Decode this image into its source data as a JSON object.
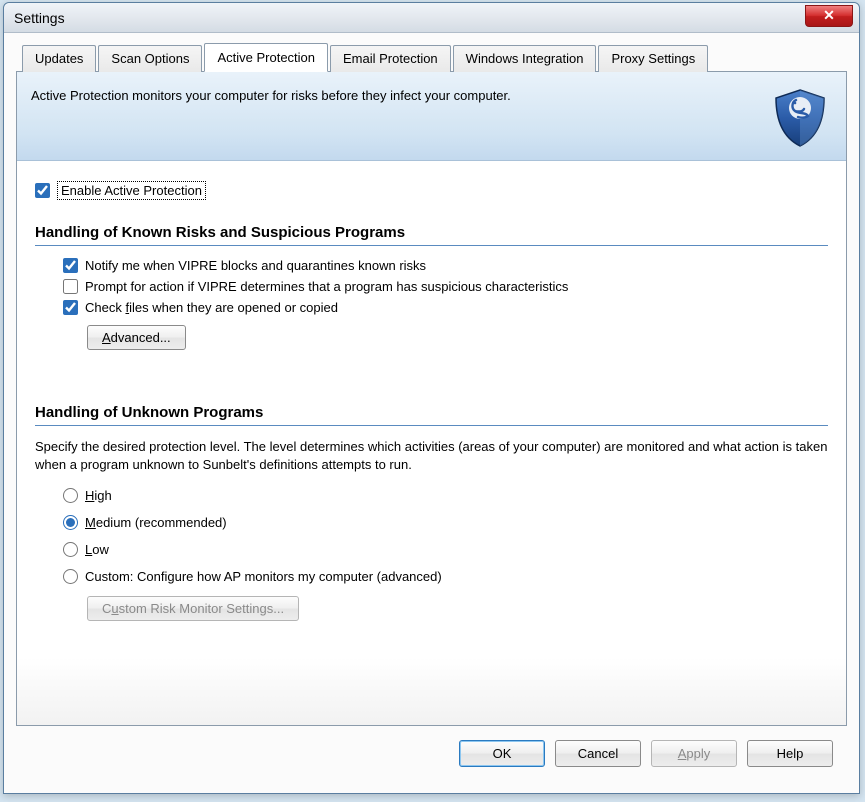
{
  "window": {
    "title": "Settings"
  },
  "tabs": [
    {
      "label": "Updates"
    },
    {
      "label": "Scan Options"
    },
    {
      "label": "Active Protection"
    },
    {
      "label": "Email Protection"
    },
    {
      "label": "Windows Integration"
    },
    {
      "label": "Proxy Settings"
    }
  ],
  "banner": {
    "text": "Active Protection monitors your computer for risks before they infect your computer."
  },
  "enable": {
    "label": "Enable Active Protection"
  },
  "section1": {
    "title": "Handling of Known Risks and Suspicious Programs",
    "notify": "Notify me when VIPRE blocks and quarantines known risks",
    "prompt": "Prompt for action if VIPRE determines that a program has suspicious characteristics",
    "checkfiles_prefix": "Check ",
    "checkfiles_u": "f",
    "checkfiles_suffix": "iles when they are opened or copied",
    "advanced_u": "A",
    "advanced_suffix": "dvanced..."
  },
  "section2": {
    "title": "Handling of Unknown Programs",
    "desc": "Specify the desired protection level. The level determines which activities (areas of your computer) are monitored and what action is taken when a program unknown to Sunbelt's definitions attempts to run.",
    "high_u": "H",
    "high_suffix": "igh",
    "medium_u": "M",
    "medium_suffix": "edium (recommended)",
    "low_u": "L",
    "low_suffix": "ow",
    "custom": "Custom: Configure how AP monitors my computer (advanced)",
    "custom_btn_prefix": "C",
    "custom_btn_u": "u",
    "custom_btn_suffix": "stom Risk Monitor Settings..."
  },
  "footer": {
    "ok": "OK",
    "cancel": "Cancel",
    "apply_u": "A",
    "apply_suffix": "pply",
    "help": "Help"
  }
}
